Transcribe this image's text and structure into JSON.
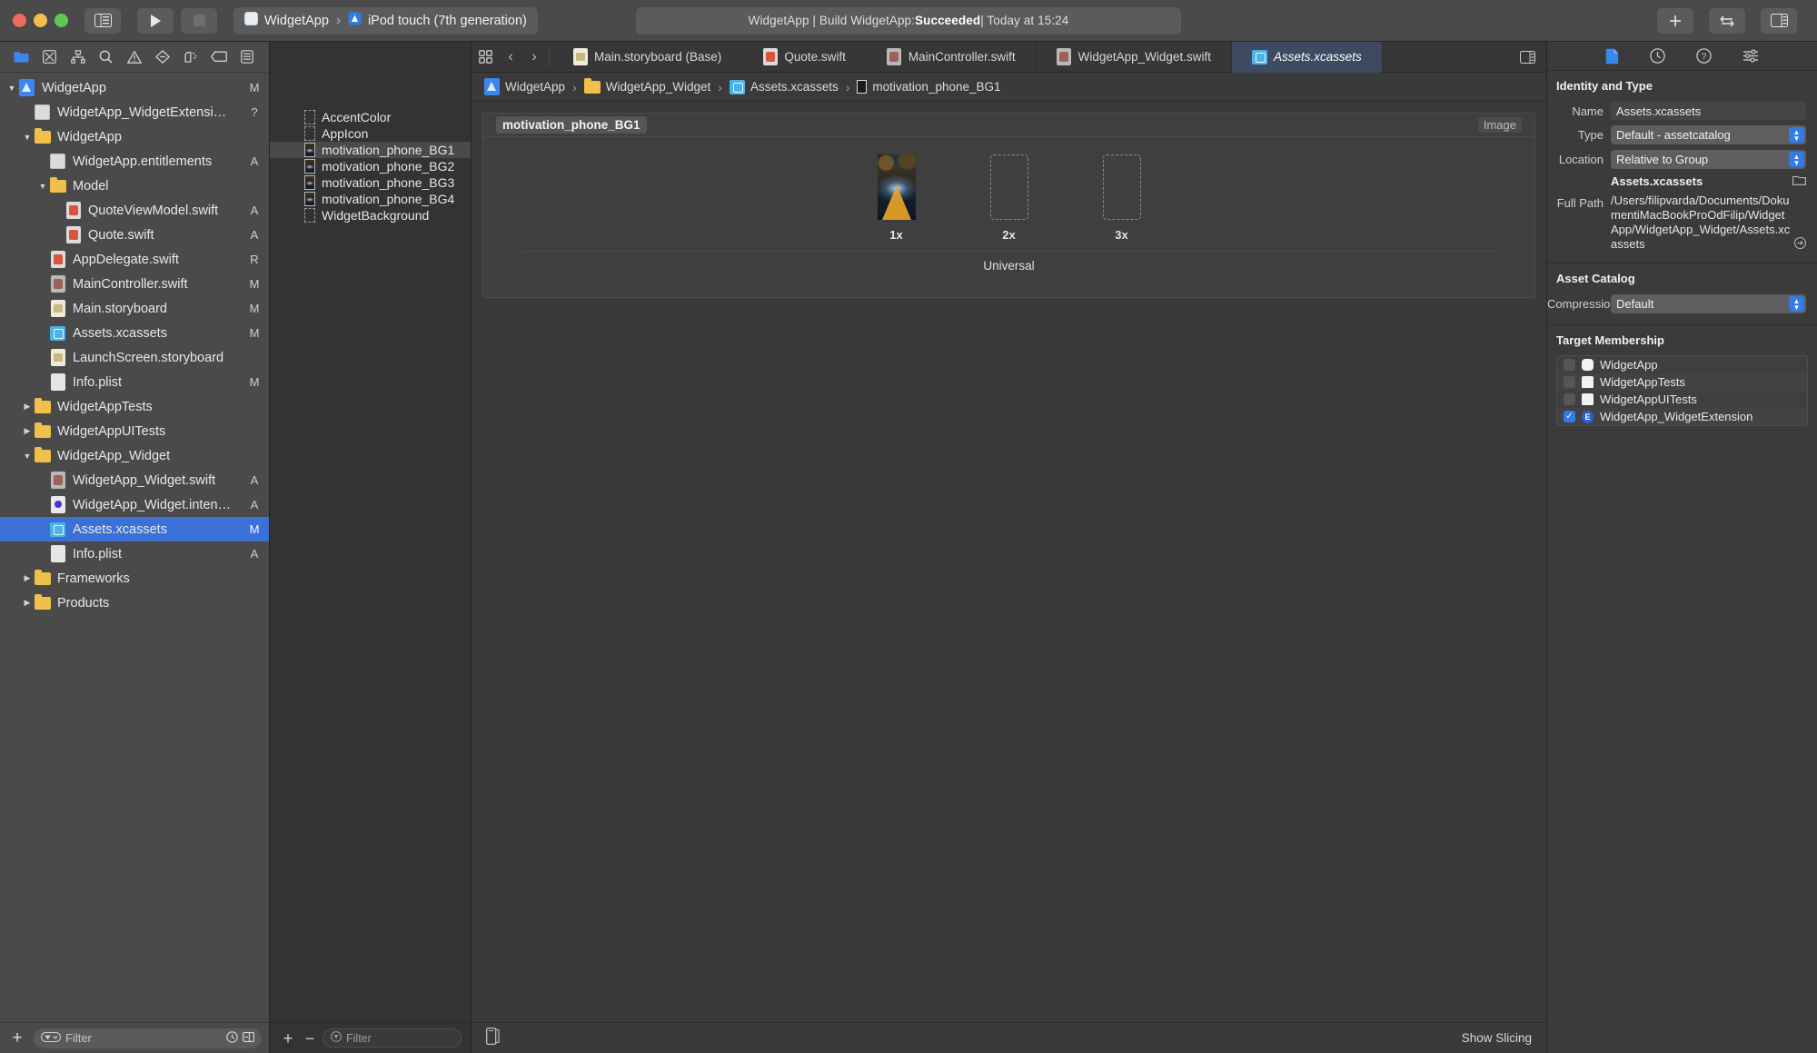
{
  "titlebar": {
    "sidebar_toggle": "toggle-navigator",
    "run_label": "Run",
    "stop_label": "Stop",
    "scheme_name": "WidgetApp",
    "scheme_separator": "›",
    "destination": "iPod touch (7th generation)",
    "status_prefix": "WidgetApp | Build WidgetApp: ",
    "status_result": "Succeeded",
    "status_suffix": " | Today at 15:24",
    "add_label": "+",
    "library_label": "Library"
  },
  "navigator": {
    "toolbar_icons": [
      "project-navigator-icon",
      "source-control-navigator-icon",
      "symbol-navigator-icon",
      "find-navigator-icon",
      "issue-navigator-icon",
      "test-navigator-icon",
      "debug-navigator-icon",
      "breakpoint-navigator-icon",
      "report-navigator-icon"
    ],
    "tree": [
      {
        "label": "WidgetApp",
        "status": "M",
        "indent": 0,
        "twisty": "down",
        "icon": "xcode-project-icon"
      },
      {
        "label": "WidgetApp_WidgetExtensi…",
        "status": "?",
        "indent": 1,
        "twisty": "",
        "icon": "entitlements-icon"
      },
      {
        "label": "WidgetApp",
        "status": "",
        "indent": 1,
        "twisty": "down",
        "icon": "folder-icon"
      },
      {
        "label": "WidgetApp.entitlements",
        "status": "A",
        "indent": 2,
        "twisty": "",
        "icon": "entitlements-icon"
      },
      {
        "label": "Model",
        "status": "",
        "indent": 2,
        "twisty": "down",
        "icon": "folder-icon"
      },
      {
        "label": "QuoteViewModel.swift",
        "status": "A",
        "indent": 3,
        "twisty": "",
        "icon": "swift-file-icon"
      },
      {
        "label": "Quote.swift",
        "status": "A",
        "indent": 3,
        "twisty": "",
        "icon": "swift-file-icon"
      },
      {
        "label": "AppDelegate.swift",
        "status": "R",
        "indent": 2,
        "twisty": "",
        "icon": "swift-file-icon"
      },
      {
        "label": "MainController.swift",
        "status": "M",
        "indent": 2,
        "twisty": "",
        "icon": "swift-file-dim-icon"
      },
      {
        "label": "Main.storyboard",
        "status": "M",
        "indent": 2,
        "twisty": "",
        "icon": "storyboard-icon"
      },
      {
        "label": "Assets.xcassets",
        "status": "M",
        "indent": 2,
        "twisty": "",
        "icon": "xcassets-icon"
      },
      {
        "label": "LaunchScreen.storyboard",
        "status": "",
        "indent": 2,
        "twisty": "",
        "icon": "storyboard-icon"
      },
      {
        "label": "Info.plist",
        "status": "M",
        "indent": 2,
        "twisty": "",
        "icon": "plist-icon"
      },
      {
        "label": "WidgetAppTests",
        "status": "",
        "indent": 1,
        "twisty": "right",
        "icon": "folder-icon"
      },
      {
        "label": "WidgetAppUITests",
        "status": "",
        "indent": 1,
        "twisty": "right",
        "icon": "folder-icon"
      },
      {
        "label": "WidgetApp_Widget",
        "status": "",
        "indent": 1,
        "twisty": "down",
        "icon": "folder-icon"
      },
      {
        "label": "WidgetApp_Widget.swift",
        "status": "A",
        "indent": 2,
        "twisty": "",
        "icon": "swift-file-dim-icon"
      },
      {
        "label": "WidgetApp_Widget.inten…",
        "status": "A",
        "indent": 2,
        "twisty": "",
        "icon": "intent-icon"
      },
      {
        "label": "Assets.xcassets",
        "status": "M",
        "indent": 2,
        "twisty": "",
        "icon": "xcassets-icon",
        "selected": true
      },
      {
        "label": "Info.plist",
        "status": "A",
        "indent": 2,
        "twisty": "",
        "icon": "plist-icon"
      },
      {
        "label": "Frameworks",
        "status": "",
        "indent": 1,
        "twisty": "right",
        "icon": "folder-icon"
      },
      {
        "label": "Products",
        "status": "",
        "indent": 1,
        "twisty": "right",
        "icon": "folder-icon"
      }
    ],
    "filter_placeholder": "Filter",
    "add_button": "+"
  },
  "assets": {
    "items": [
      {
        "label": "AccentColor",
        "kind": "color-swatch-empty"
      },
      {
        "label": "AppIcon",
        "kind": "appicon-empty"
      },
      {
        "label": "motivation_phone_BG1",
        "kind": "image-thumb",
        "selected": true
      },
      {
        "label": "motivation_phone_BG2",
        "kind": "image-thumb"
      },
      {
        "label": "motivation_phone_BG3",
        "kind": "image-thumb"
      },
      {
        "label": "motivation_phone_BG4",
        "kind": "image-thumb"
      },
      {
        "label": "WidgetBackground",
        "kind": "color-swatch-empty"
      }
    ],
    "add_button": "+",
    "remove_button": "−",
    "filter_placeholder": "Filter"
  },
  "editor": {
    "tabs": [
      {
        "label": "Main.storyboard (Base)",
        "icon": "storyboard-icon",
        "active": false
      },
      {
        "label": "Quote.swift",
        "icon": "swift-file-icon",
        "active": false
      },
      {
        "label": "MainController.swift",
        "icon": "swift-file-dim-icon",
        "active": false
      },
      {
        "label": "WidgetApp_Widget.swift",
        "icon": "swift-file-dim-icon",
        "active": false
      },
      {
        "label": "Assets.xcassets",
        "icon": "xcassets-icon",
        "active": true
      }
    ],
    "breadcrumb": [
      {
        "label": "WidgetApp",
        "icon": "xcode-project-icon"
      },
      {
        "label": "WidgetApp_Widget",
        "icon": "folder-icon"
      },
      {
        "label": "Assets.xcassets",
        "icon": "xcassets-icon"
      },
      {
        "label": "motivation_phone_BG1",
        "icon": "image-set-icon"
      }
    ],
    "breadcrumb_separator": "›",
    "canvas_title": "motivation_phone_BG1",
    "canvas_kind": "Image",
    "slots": [
      {
        "label": "1x",
        "filled": true
      },
      {
        "label": "2x",
        "filled": false
      },
      {
        "label": "3x",
        "filled": false
      }
    ],
    "device_class": "Universal",
    "show_slicing": "Show Slicing"
  },
  "inspector": {
    "tabs": [
      "file-inspector-icon",
      "history-inspector-icon",
      "quick-help-icon",
      "attributes-inspector-icon"
    ],
    "identity_section": "Identity and Type",
    "name_label": "Name",
    "name_value": "Assets.xcassets",
    "type_label": "Type",
    "type_value": "Default - assetcatalog",
    "location_label": "Location",
    "location_value": "Relative to Group",
    "location_file": "Assets.xcassets",
    "full_path_label": "Full Path",
    "full_path_value": "/Users/filipvarda/Documents/DokumentiMacBookProOdFilip/WidgetApp/WidgetApp_Widget/Assets.xcassets",
    "asset_catalog_section": "Asset Catalog",
    "compression_label": "Compression",
    "compression_value": "Default",
    "target_membership_section": "Target Membership",
    "targets": [
      {
        "label": "WidgetApp",
        "checked": false,
        "icon": "app-icon"
      },
      {
        "label": "WidgetAppTests",
        "checked": false,
        "icon": "test-bundle-icon"
      },
      {
        "label": "WidgetAppUITests",
        "checked": false,
        "icon": "test-bundle-icon"
      },
      {
        "label": "WidgetApp_WidgetExtension",
        "checked": true,
        "icon": "extension-icon"
      }
    ],
    "checkmark": "✓"
  },
  "colors": {
    "accent_blue": "#3b87f0",
    "selection_blue": "#3b71d6",
    "active_tab_blue": "#3d4a61",
    "titlebar_gray": "#4a4a4a",
    "editor_gray": "#3a3a3a"
  }
}
